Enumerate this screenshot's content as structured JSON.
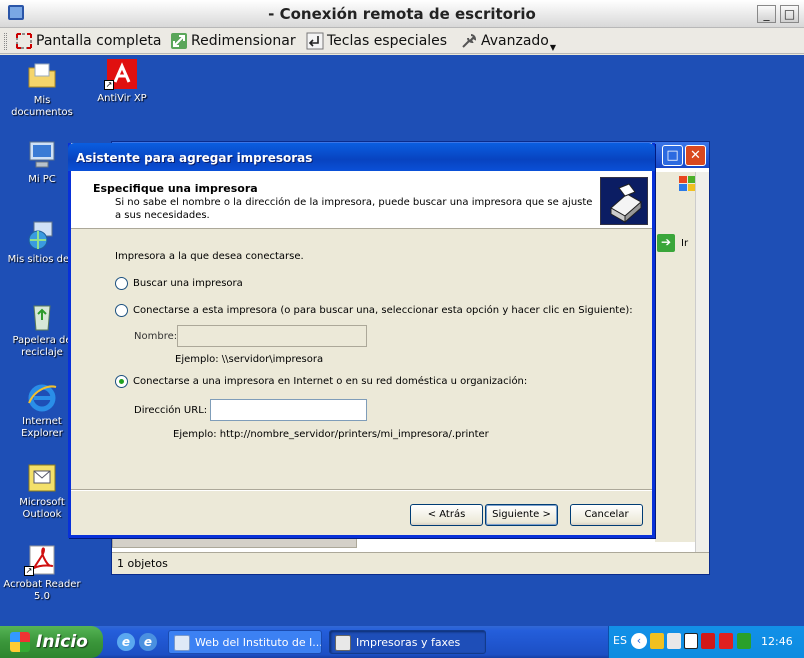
{
  "remote_window": {
    "title": "- Conexión remota de escritorio",
    "controls": {
      "minimize": "_",
      "maximize": "□"
    }
  },
  "toolbar": {
    "fullscreen": "Pantalla completa",
    "resize": "Redimensionar",
    "special_keys": "Teclas especiales",
    "advanced": "Avanzado"
  },
  "desktop_icons": [
    {
      "label": "Mis documentos"
    },
    {
      "label": "AntiVir XP"
    },
    {
      "label": "Mi PC"
    },
    {
      "label": "Mis sitios de r"
    },
    {
      "label": "Papelera de reciclaje"
    },
    {
      "label": "Internet Explorer"
    },
    {
      "label": "Microsoft Outlook"
    },
    {
      "label": "Acrobat Reader 5.0"
    }
  ],
  "background_window": {
    "go_label": "Ir",
    "status": "1 objetos"
  },
  "wizard": {
    "title": "Asistente para agregar impresoras",
    "heading": "Especifique una impresora",
    "subheading": "Si no sabe el nombre o la dirección de la impresora, puede buscar una impresora que se ajuste a sus necesidades.",
    "prompt": "Impresora a la que desea conectarse.",
    "option_search": "Buscar una impresora",
    "option_connect": "Conectarse a esta impresora (o para buscar una, seleccionar esta opción y hacer clic en Siguiente):",
    "name_label": "Nombre:",
    "name_value": "",
    "name_example": "Ejemplo: \\\\servidor\\impresora",
    "option_internet": "Conectarse a una impresora en Internet o en su red doméstica u organización:",
    "url_label": "Dirección URL:",
    "url_value": "",
    "url_example": "Ejemplo: http://nombre_servidor/printers/mi_impresora/.printer",
    "selected_option": "internet",
    "back_button": "< Atrás",
    "next_button": "Siguiente >",
    "cancel_button": "Cancelar"
  },
  "taskbar": {
    "start_label": "Inicio",
    "tasks": [
      {
        "label": "Web del Instituto de l..."
      },
      {
        "label": "Impresoras y faxes"
      }
    ],
    "language": "ES",
    "clock": "12:46"
  },
  "colors": {
    "desktop": "#1e4fb6",
    "xp_title_blue": "#0a5ee0",
    "taskbar_blue": "#245edb",
    "start_green": "#3a963a",
    "dialog_face": "#ece9d8"
  }
}
